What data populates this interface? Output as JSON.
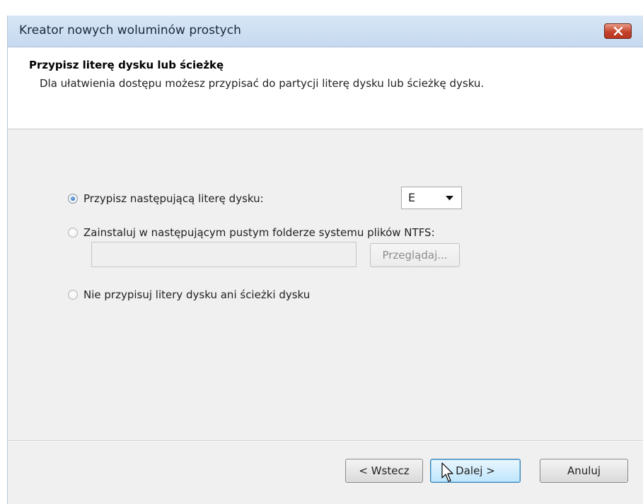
{
  "window": {
    "title": "Kreator nowych woluminów prostych",
    "close_icon": "close-icon"
  },
  "header": {
    "title": "Przypisz literę dysku lub ścieżkę",
    "description": "Dla ułatwienia dostępu możesz przypisać do partycji literę dysku lub ścieżkę dysku."
  },
  "options": {
    "assign_letter": {
      "label": "Przypisz następującą literę dysku:",
      "checked": true
    },
    "mount_folder": {
      "label": "Zainstaluj w następującym pustym folderze systemu plików NTFS:",
      "checked": false
    },
    "no_assign": {
      "label": "Nie przypisuj litery dysku ani ścieżki dysku",
      "checked": false
    }
  },
  "drive_letter": {
    "selected": "E"
  },
  "folder_path": {
    "value": ""
  },
  "buttons": {
    "browse": "Przeglądaj...",
    "back": "< Wstecz",
    "next": "Dalej >",
    "cancel": "Anuluj"
  },
  "colors": {
    "title_bar": "#c6d9ef",
    "close_button": "#c5432b",
    "focused_button": "#bee6fd"
  }
}
